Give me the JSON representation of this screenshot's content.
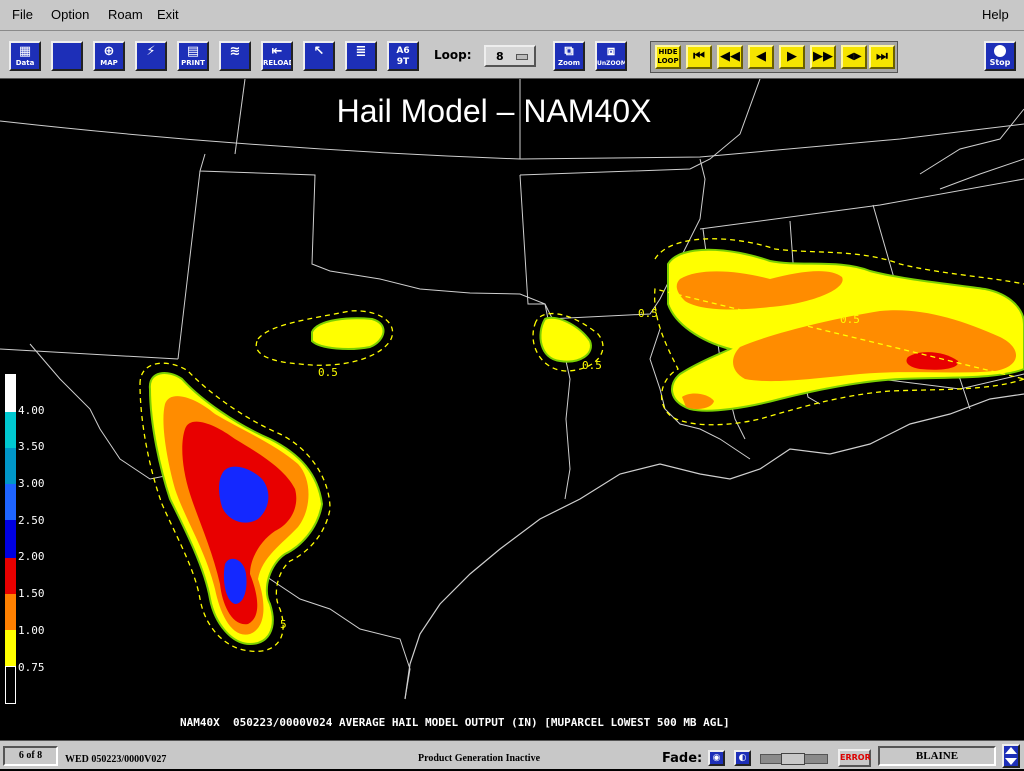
{
  "menubar": {
    "file": "File",
    "option": "Option",
    "roam": "Roam",
    "exit": "Exit",
    "help": "Help"
  },
  "toolbar": {
    "data": "Data",
    "map": "MAP",
    "print": "PRINT",
    "reload": "RELOAD",
    "text_btn": "A6\n9T",
    "loop_label": "Loop:",
    "loop_value": "8",
    "zoom": "Zoom",
    "unzoom": "UnZOOM",
    "hide_loop": "HIDE\nLOOP",
    "stop": "Stop"
  },
  "map": {
    "title": "Hail Model – NAM40X",
    "caption": "NAM40X  050223/0000V024 AVERAGE HAIL MODEL OUTPUT (IN) [MUPARCEL LOWEST 500 MB AGL]",
    "contour_labels": [
      "0.5",
      "0.5",
      "0.5",
      "0.5",
      "5"
    ],
    "legend": {
      "labels": [
        "4.00",
        "3.50",
        "3.00",
        "2.50",
        "2.00",
        "1.50",
        "1.00",
        "0.75"
      ],
      "colors": [
        "#ffffff",
        "#00c8d0",
        "#0096c8",
        "#1e64ff",
        "#0000e0",
        "#e80000",
        "#ff8000",
        "#ffff00",
        "#000000"
      ]
    },
    "colors": {
      "hail_075": "#ffff00",
      "hail_100": "#ff8c00",
      "hail_150": "#e80000",
      "hail_200": "#1428ff",
      "edge": "#7cd000",
      "contour": "#ffff00",
      "borders": "#cfcfcf"
    }
  },
  "statusbar": {
    "frame": "6 of  8",
    "datetime": "WED 050223/0000V027",
    "status": "Product Generation Inactive",
    "fade_label": "Fade:",
    "error": "ERROR",
    "site": "BLAINE"
  }
}
